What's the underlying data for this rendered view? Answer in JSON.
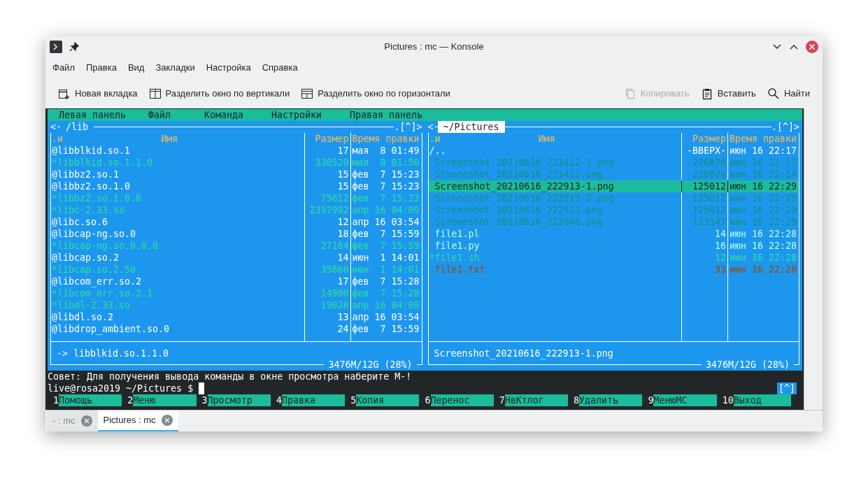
{
  "window": {
    "title": "Pictures : mc — Konsole"
  },
  "menu": [
    "Файл",
    "Правка",
    "Вид",
    "Закладки",
    "Настройка",
    "Справка"
  ],
  "toolbar": [
    {
      "label": "Новая вкладка",
      "disabled": false
    },
    {
      "label": "Разделить окно по вертикали",
      "disabled": false
    },
    {
      "label": "Разделить окно по горизонтали",
      "disabled": false
    },
    {
      "label": "Копировать",
      "disabled": true
    },
    {
      "label": "Вставить",
      "disabled": false
    },
    {
      "label": "Найти",
      "disabled": false
    }
  ],
  "mc_menu": [
    "Левая панель",
    "Файл",
    "Команда",
    "Настройки",
    "Правая панель"
  ],
  "panels": [
    {
      "path": "/lib",
      "active": false,
      "corner_left": "<",
      "corner_right": ".[^]>",
      "columns": [
        ".и",
        "Имя",
        "Размер",
        "Время правки"
      ],
      "files": [
        {
          "name": "@libblkid.so.1",
          "size": "17",
          "time": "мая  8 01:49",
          "kind": "link",
          "selected": false
        },
        {
          "name": "*libblkid.so.1.1.0",
          "size": "330520",
          "time": "мая  8 01:50",
          "kind": "exec",
          "selected": false
        },
        {
          "name": "@libbz2.so.1",
          "size": "15",
          "time": "фев  7 15:23",
          "kind": "link",
          "selected": false
        },
        {
          "name": "@libbz2.so.1.0",
          "size": "15",
          "time": "фев  7 15:23",
          "kind": "link",
          "selected": false
        },
        {
          "name": "*libbz2.so.1.0.8",
          "size": "75612",
          "time": "фев  7 15:23",
          "kind": "exec",
          "selected": false
        },
        {
          "name": "*libc-2.33.so",
          "size": "2397992",
          "time": "апр 16 04:09",
          "kind": "exec",
          "selected": false
        },
        {
          "name": "@libc.so.6",
          "size": "12",
          "time": "апр 16 03:54",
          "kind": "link",
          "selected": false
        },
        {
          "name": "@libcap-ng.so.0",
          "size": "18",
          "time": "фев  7 15:59",
          "kind": "link",
          "selected": false
        },
        {
          "name": "*libcap-ng.so.0.0.0",
          "size": "27164",
          "time": "фев  7 15:59",
          "kind": "exec",
          "selected": false
        },
        {
          "name": "@libcap.so.2",
          "size": "14",
          "time": "июн  1 14:01",
          "kind": "link",
          "selected": false
        },
        {
          "name": "*libcap.so.2.50",
          "size": "35860",
          "time": "июн  1 14:01",
          "kind": "exec",
          "selected": false
        },
        {
          "name": "@libcom_err.so.2",
          "size": "17",
          "time": "фев  7 15:28",
          "kind": "link",
          "selected": false
        },
        {
          "name": "*libcom_err.so.2.1",
          "size": "14900",
          "time": "фев  7 15:28",
          "kind": "exec",
          "selected": false
        },
        {
          "name": "*libdl-2.33.so",
          "size": "19028",
          "time": "апр 16 04:09",
          "kind": "exec",
          "selected": false
        },
        {
          "name": "@libdl.so.2",
          "size": "13",
          "time": "апр 16 03:54",
          "kind": "link",
          "selected": false
        },
        {
          "name": "@libdrop_ambient.so.0",
          "size": "24",
          "time": "фев  7 15:59",
          "kind": "link",
          "selected": false
        }
      ],
      "mini_status": "-> libblkid.so.1.1.0",
      "disk": "3476M/12G (28%)"
    },
    {
      "path": "~/Pictures",
      "active": true,
      "corner_left": "<",
      "corner_right": ".[^]>",
      "columns": [
        ".и",
        "Имя",
        "Размер",
        "Время правки"
      ],
      "files": [
        {
          "name": "/..",
          "size": "-ВВЕРХ-",
          "time": "июн 16 22:17",
          "kind": "dir",
          "selected": false
        },
        {
          "name": "Screenshot_20210616_221412-1.png",
          "size": "236870",
          "time": "июн 16 22:17",
          "kind": "image",
          "selected": false
        },
        {
          "name": "Screenshot_20210616_221412.png",
          "size": "236870",
          "time": "июн 16 22:14",
          "kind": "image",
          "selected": false
        },
        {
          "name": "Screenshot_20210616_222913-1.png",
          "size": "125012",
          "time": "июн 16 22:29",
          "kind": "image",
          "selected": true
        },
        {
          "name": "Screenshot_20210616_222913-2.png",
          "size": "125012",
          "time": "июн 16 22:29",
          "kind": "image",
          "selected": false
        },
        {
          "name": "Screenshot_20210616_222913.png",
          "size": "125012",
          "time": "июн 16 22:29",
          "kind": "image",
          "selected": false
        },
        {
          "name": "Screenshot_20210616_222948.png",
          "size": "133147",
          "time": "июн 16 22:29",
          "kind": "image",
          "selected": false
        },
        {
          "name": "file1.pl",
          "size": "14",
          "time": "июн 16 22:28",
          "kind": "source",
          "selected": false
        },
        {
          "name": "file1.py",
          "size": "16",
          "time": "июн 16 22:28",
          "kind": "source",
          "selected": false
        },
        {
          "name": "*file1.sh",
          "size": "12",
          "time": "июн 16 22:28",
          "kind": "exec",
          "selected": false
        },
        {
          "name": "file1.txt",
          "size": "33",
          "time": "июн 16 22:28",
          "kind": "text",
          "selected": false
        }
      ],
      "mini_status": "Screenshot_20210616_222913-1.png",
      "disk": "3476M/12G (28%)"
    }
  ],
  "hint": "Совет: Для получения вывода команды в окне просмотра наберите M-!",
  "prompt": "live@rosa2019 ~/Pictures $ ",
  "prompt_flag": "[^]",
  "function_keys": [
    {
      "number": "1",
      "label": "Помощь"
    },
    {
      "number": "2",
      "label": "Меню"
    },
    {
      "number": "3",
      "label": "Просмотр"
    },
    {
      "number": "4",
      "label": "Правка"
    },
    {
      "number": "5",
      "label": "Копия"
    },
    {
      "number": "6",
      "label": "Перенос"
    },
    {
      "number": "7",
      "label": "НвКтлог"
    },
    {
      "number": "8",
      "label": "Удалить"
    },
    {
      "number": "9",
      "label": "МенюМС"
    },
    {
      "number": "10",
      "label": "Выход"
    }
  ],
  "tabs": [
    {
      "label": "- : mc",
      "selected": false
    },
    {
      "label": "Pictures : mc",
      "selected": true
    }
  ]
}
